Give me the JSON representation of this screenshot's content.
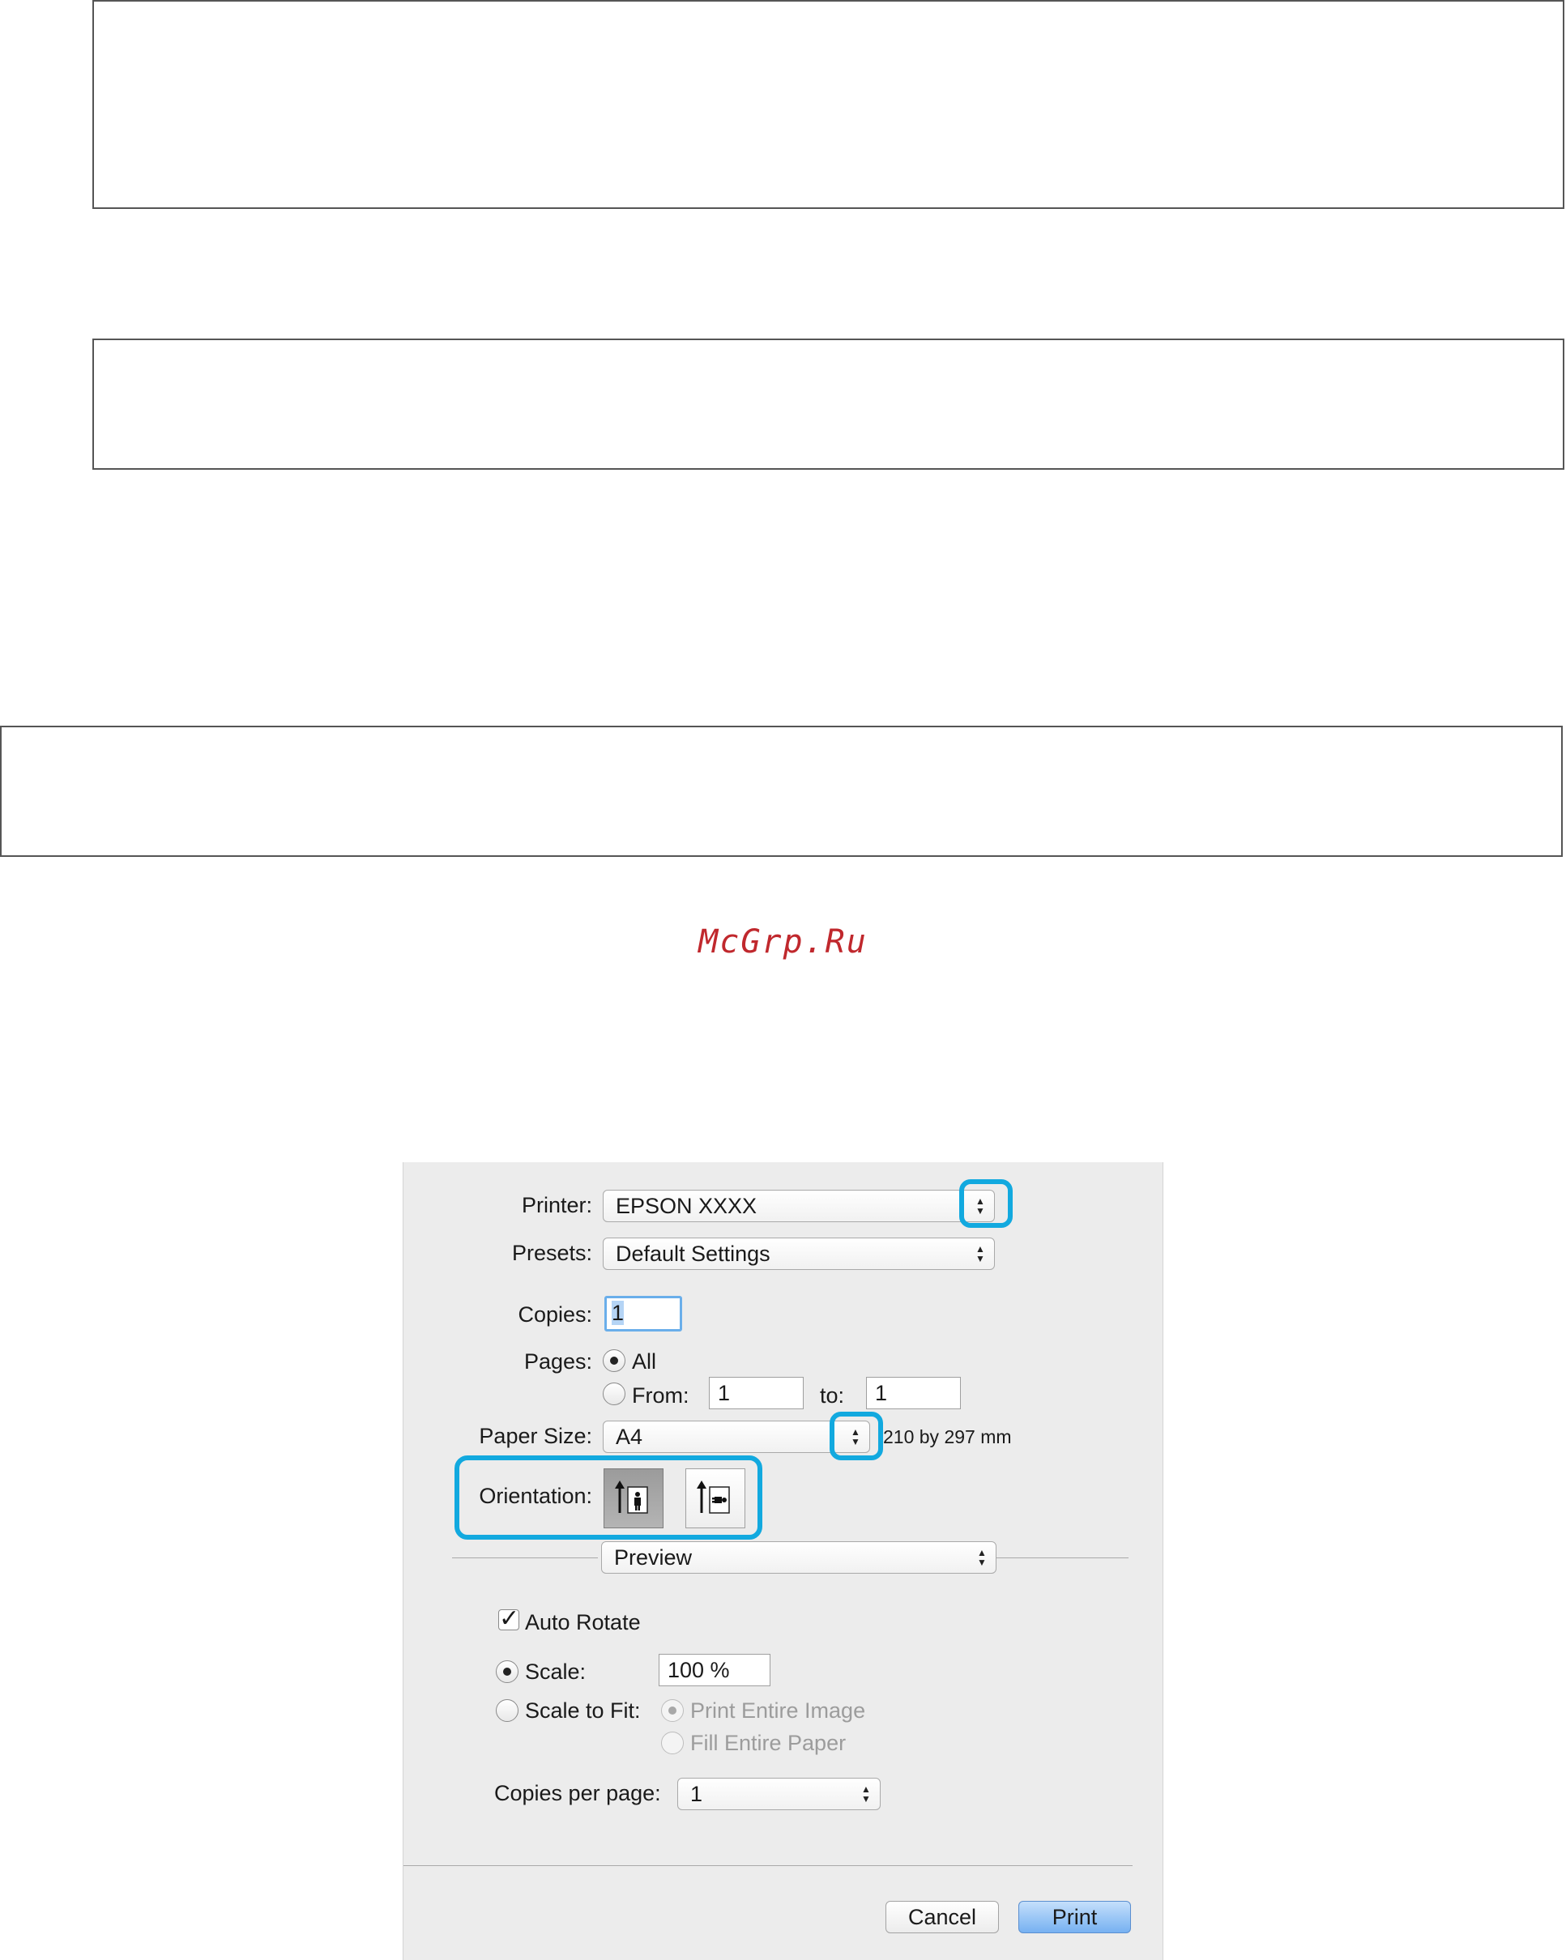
{
  "watermark": "McGrp.Ru",
  "dialog": {
    "printer": {
      "label": "Printer:",
      "value": "EPSON XXXX"
    },
    "presets": {
      "label": "Presets:",
      "value": "Default Settings"
    },
    "copies": {
      "label": "Copies:",
      "value": "1"
    },
    "pages": {
      "label": "Pages:",
      "all_label": "All",
      "from_label": "From:",
      "from_value": "1",
      "to_label": "to:",
      "to_value": "1",
      "selected": "All"
    },
    "paper_size": {
      "label": "Paper Size:",
      "value": "A4",
      "dimensions": "210 by 297 mm"
    },
    "orientation": {
      "label": "Orientation:",
      "selected": "portrait"
    },
    "section_popup": {
      "value": "Preview"
    },
    "auto_rotate": {
      "label": "Auto Rotate",
      "checked": true
    },
    "scale": {
      "label": "Scale:",
      "value": "100 %",
      "selected": true
    },
    "scale_to_fit": {
      "label": "Scale to Fit:",
      "option_print_entire_image": "Print Entire Image",
      "option_fill_entire_paper": "Fill Entire Paper"
    },
    "copies_per_page": {
      "label": "Copies per page:",
      "value": "1"
    },
    "buttons": {
      "cancel": "Cancel",
      "print": "Print"
    }
  },
  "colors": {
    "highlight": "#12a9df",
    "watermark": "#c0282d",
    "primary_button": "#77b1f1"
  },
  "icons": [
    "chevron-updown-icon",
    "portrait-orientation-icon",
    "landscape-orientation-icon",
    "checkmark-icon"
  ]
}
